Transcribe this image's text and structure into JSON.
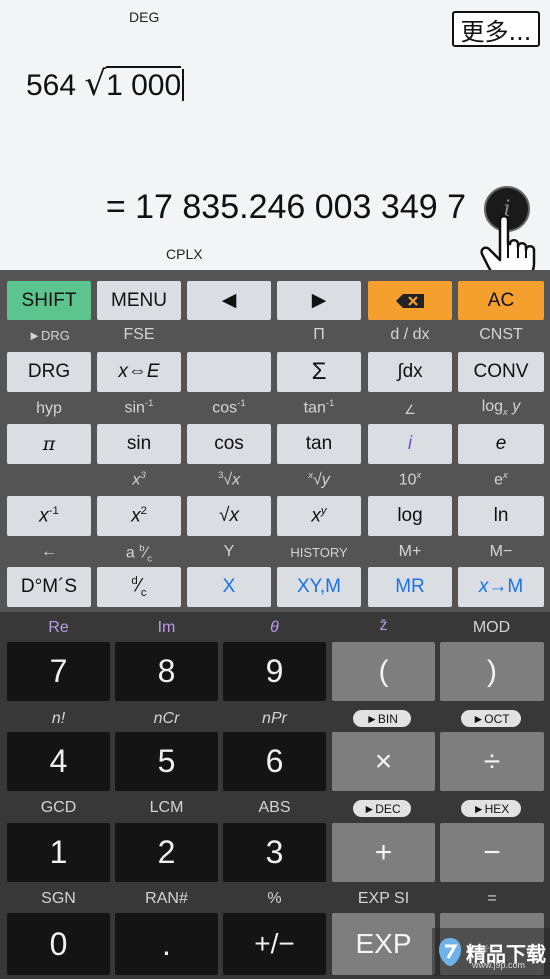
{
  "display": {
    "angle_mode": "DEG",
    "more_label": "更多...",
    "expression_prefix": "564",
    "radical": "√",
    "radicand": "1 000",
    "result": "= 17 835.246 003 349 7",
    "mode": "CPLX",
    "info_label": "i"
  },
  "row0": {
    "shift": "SHIFT",
    "menu": "MENU",
    "left": "◀",
    "right": "▶",
    "backspace": "⌫",
    "ac": "AC"
  },
  "row1_labels": [
    "►DRG",
    "FSE",
    "",
    "Π",
    "d / dx",
    "CNST"
  ],
  "row1": [
    "DRG",
    "x⇔E",
    "",
    "Σ",
    "∫dx",
    "CONV"
  ],
  "row2_labels": [
    "hyp",
    "sin-1",
    "cos-1",
    "tan-1",
    "∠",
    "logx y"
  ],
  "row2": [
    "π",
    "sin",
    "cos",
    "tan",
    "i",
    "e"
  ],
  "row3_labels": [
    "",
    "x3",
    "3√x",
    "x√y",
    "10x",
    "ex"
  ],
  "row3": [
    "x-1",
    "x2",
    "√x",
    "xy",
    "log",
    "ln"
  ],
  "row4_labels": [
    "←",
    "a b/c",
    "Y",
    "HISTORY",
    "M+",
    "M−"
  ],
  "row4": [
    "D°M´S",
    "d/c",
    "X",
    "XY,M",
    "MR",
    "x→M"
  ],
  "row5_labels": [
    "Re",
    "Im",
    "θ",
    "z̄",
    "MOD"
  ],
  "row5": [
    "7",
    "8",
    "9",
    "(",
    ")"
  ],
  "row6_labels": [
    "n!",
    "nCr",
    "nPr",
    "►BIN",
    "►OCT"
  ],
  "row6": [
    "4",
    "5",
    "6",
    "×",
    "÷"
  ],
  "row7_labels": [
    "GCD",
    "LCM",
    "ABS",
    "►DEC",
    "►HEX"
  ],
  "row7": [
    "1",
    "2",
    "3",
    "+",
    "−"
  ],
  "row8_labels": [
    "SGN",
    "RAN#",
    "%",
    "EXP SI",
    "="
  ],
  "row8": [
    "0",
    ".",
    "+/−",
    "EXP",
    "←"
  ],
  "watermark": {
    "title": "精品下载",
    "url": "www.j9p.com"
  }
}
